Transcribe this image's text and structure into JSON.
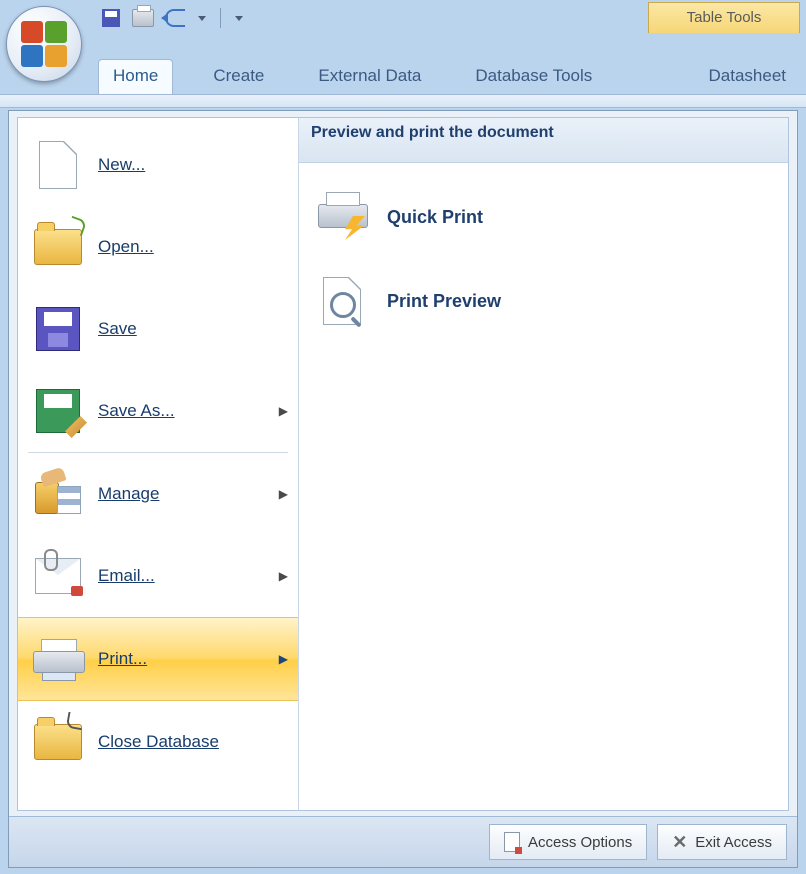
{
  "context_tab": "Table Tools",
  "tabs": {
    "home": "Home",
    "create": "Create",
    "external": "External Data",
    "dbtools": "Database Tools",
    "datasheet": "Datasheet"
  },
  "menu": {
    "new": "New...",
    "open": "Open...",
    "save": "Save",
    "save_as": "Save As...",
    "manage": "Manage",
    "email": "Email...",
    "print": "Print...",
    "close_db": "Close Database"
  },
  "submenu": {
    "header": "Preview and print the document",
    "quick_print": "Quick Print",
    "print_preview": "Print Preview"
  },
  "footer": {
    "options": "Access Options",
    "exit": "Exit Access"
  }
}
